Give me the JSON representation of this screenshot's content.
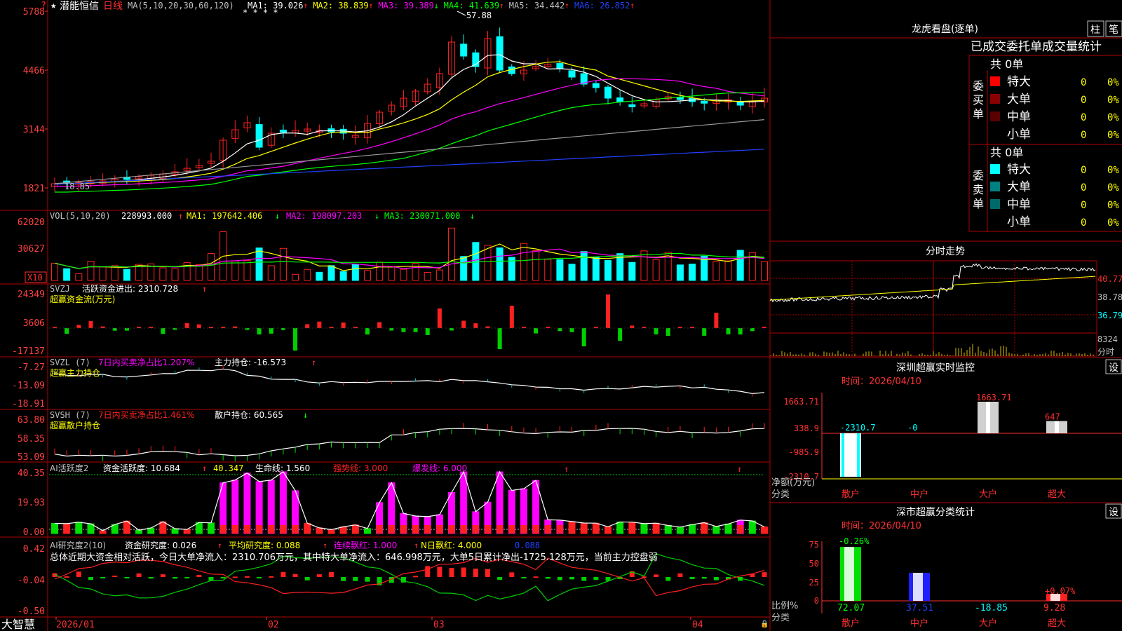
{
  "colors": {
    "up": "#ff2020",
    "down": "#00ffff",
    "white": "#ffffff",
    "yellow": "#ffff00",
    "magenta": "#ff00ff",
    "green": "#00e000",
    "gray": "#9a9a9a",
    "blue": "#2030ff",
    "axis": "#ff3030",
    "bg": "#000000",
    "grid": "#a00000"
  },
  "icons": [
    "star-icon",
    "lock-icon"
  ],
  "kline": {
    "title": "潜能恒信",
    "period": "日线",
    "ma_def": "MA(5,10,20,30,60,120)",
    "ma": [
      {
        "label": "MA1: 39.026",
        "arrow": "↑",
        "color": "#ffffff"
      },
      {
        "label": "MA2: 38.839",
        "arrow": "↑",
        "color": "#ffff00"
      },
      {
        "label": "MA3: 39.389",
        "arrow": "↓",
        "color": "#ff00ff"
      },
      {
        "label": "MA4: 41.639",
        "arrow": "↑",
        "color": "#00ff00"
      },
      {
        "label": "MA5: 34.442",
        "arrow": "↑",
        "color": "#c0c0c0"
      },
      {
        "label": "MA6: 26.852",
        "arrow": "↑",
        "color": "#2040ff"
      }
    ],
    "y_ticks": [
      "5788",
      "4466",
      "3144",
      "1821"
    ],
    "high_label": "57.88",
    "low_label": "18.85",
    "markers": "* * * *"
  },
  "vol": {
    "header": "VOL(5,10,20)",
    "value": "228993.000",
    "arrow": "↑",
    "ma1": "MA1: 197642.406",
    "ma1_arrow": "↓",
    "ma2": "MA2: 198097.203",
    "ma2_arrow": "↓",
    "ma3": "MA3: 230071.000",
    "ma3_arrow": "↓",
    "y_ticks": [
      "62020",
      "30627"
    ],
    "unit": "X10"
  },
  "svzj": {
    "header": "SVZJ",
    "name": "活跃资金进出: 2310.728",
    "arrow": "↑",
    "sub": "超赢资金流(万元)",
    "y_ticks": [
      "24349",
      "3606",
      "-17137"
    ]
  },
  "svzl": {
    "header": "SVZL (7)",
    "ratio": "7日内买卖净占比1.207%",
    "name": "主力持仓: -16.573",
    "arrow": "↑",
    "sub": "超赢主力持仓",
    "y_ticks": [
      "-7.27",
      "-13.09",
      "-18.91"
    ]
  },
  "svsh": {
    "header": "SVSH (7)",
    "ratio": "7日内买卖净占比1.461%",
    "name": "散户持仓: 60.565",
    "arrow": "↓",
    "sub": "超赢散户持仓",
    "y_ticks": [
      "63.80",
      "58.35",
      "53.09"
    ]
  },
  "ai1": {
    "header": "AI活跃度2",
    "a": "资金活跃度: 10.684",
    "a_arrow": "↑",
    "b": "40.347",
    "c": "生命线: 1.560",
    "d": "强势线: 3.000",
    "e": "爆发线: 6.000",
    "y_ticks": [
      "40.35",
      "19.93",
      "0.00"
    ]
  },
  "ai2": {
    "header": "AI研究度2(10)",
    "a": "资金研究度: 0.026",
    "a_arrow": "↑",
    "b": "平均研究度: 0.088",
    "b_arrow": "↑",
    "c": "连续飘红: 1.000",
    "c_arrow": "↑",
    "d": "N日飘红: 4.000",
    "e": "0.088",
    "summary": "总体近期大资金相对活跃，今日大单净流入：2310.706万元，其中特大单净流入：646.998万元，大单5日累计净出-1725.128万元，当前主力控盘弱",
    "y_ticks": [
      "0.42",
      "-0.04",
      "-0.50"
    ]
  },
  "xaxis": {
    "brand": "大智慧",
    "labels": [
      "2026/01",
      "02",
      "03",
      "04"
    ]
  },
  "right": {
    "lhb": {
      "title": "龙虎看盘(逐单)",
      "btn1": "柱",
      "btn2": "笔",
      "stat_title": "已成交委托单成交量统计",
      "buy_label": "委买单",
      "sell_label": "委卖单",
      "buy_total": "共 0单",
      "sell_total": "共 0单",
      "buy_rows": [
        {
          "name": "特大",
          "qty": "0",
          "pct": "0%",
          "color": "#ff0000"
        },
        {
          "name": "大单",
          "qty": "0",
          "pct": "0%",
          "color": "#8a0000"
        },
        {
          "name": "中单",
          "qty": "0",
          "pct": "0%",
          "color": "#5a0000"
        },
        {
          "name": "小单",
          "qty": "0",
          "pct": "0%",
          "color": ""
        }
      ],
      "sell_rows": [
        {
          "name": "特大",
          "qty": "0",
          "pct": "0%",
          "color": "#00ffff"
        },
        {
          "name": "大单",
          "qty": "0",
          "pct": "0%",
          "color": "#008080"
        },
        {
          "name": "中单",
          "qty": "0",
          "pct": "0%",
          "color": "#006a6a"
        },
        {
          "name": "小单",
          "qty": "0",
          "pct": "0%",
          "color": ""
        }
      ]
    },
    "fenshi": {
      "title": "分时走势",
      "ticks": [
        "40.77",
        "38.78",
        "36.79"
      ],
      "vol": "8324",
      "unit": "分时"
    },
    "sz_monitor": {
      "title": "深圳超赢实时监控",
      "btn": "设",
      "time": "时间：2026/04/10",
      "y_ticks": [
        "1663.71",
        "338.9",
        "-985.9",
        "-2310.7"
      ],
      "ylabel": "净额(万元)",
      "xlabel": "分类",
      "categories": [
        "散户",
        "中户",
        "大户",
        "超大"
      ],
      "values": [
        "-2310.7",
        "-0",
        "1663.71",
        "647"
      ]
    },
    "sz_class": {
      "title": "深市超赢分类统计",
      "btn": "设",
      "time": "时间：2026/04/10",
      "y_ticks": [
        "75",
        "50",
        "25",
        "0"
      ],
      "ylabel": "比例%",
      "xlabel": "分类",
      "categories": [
        "散户",
        "中户",
        "大户",
        "超大"
      ],
      "top_labels": [
        "-0.26%",
        "",
        "",
        "+0.07%"
      ],
      "values": [
        "72.07",
        "37.51",
        "-18.85",
        "9.28"
      ]
    }
  }
}
